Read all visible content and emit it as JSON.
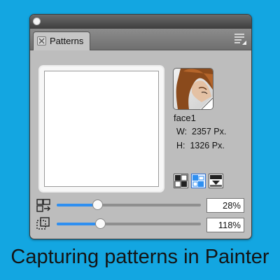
{
  "panel": {
    "tab_label": "Patterns",
    "pattern": {
      "name": "face1",
      "width": "W:  2357 Px.",
      "height": "H:  1326 Px."
    },
    "sliders": [
      {
        "icon": "scale-pattern-icon",
        "value": 0.28,
        "display": "28%"
      },
      {
        "icon": "offset-pattern-icon",
        "value": 0.3,
        "display": "118%"
      }
    ],
    "mode_buttons": [
      "rectangular-tile-icon",
      "horizontal-offset-icon",
      "vertical-offset-icon"
    ],
    "selected_mode": 1,
    "colors": {
      "accent": "#2f8ff0",
      "background": "#13a6e1"
    }
  },
  "caption": "Capturing patterns in Painter"
}
